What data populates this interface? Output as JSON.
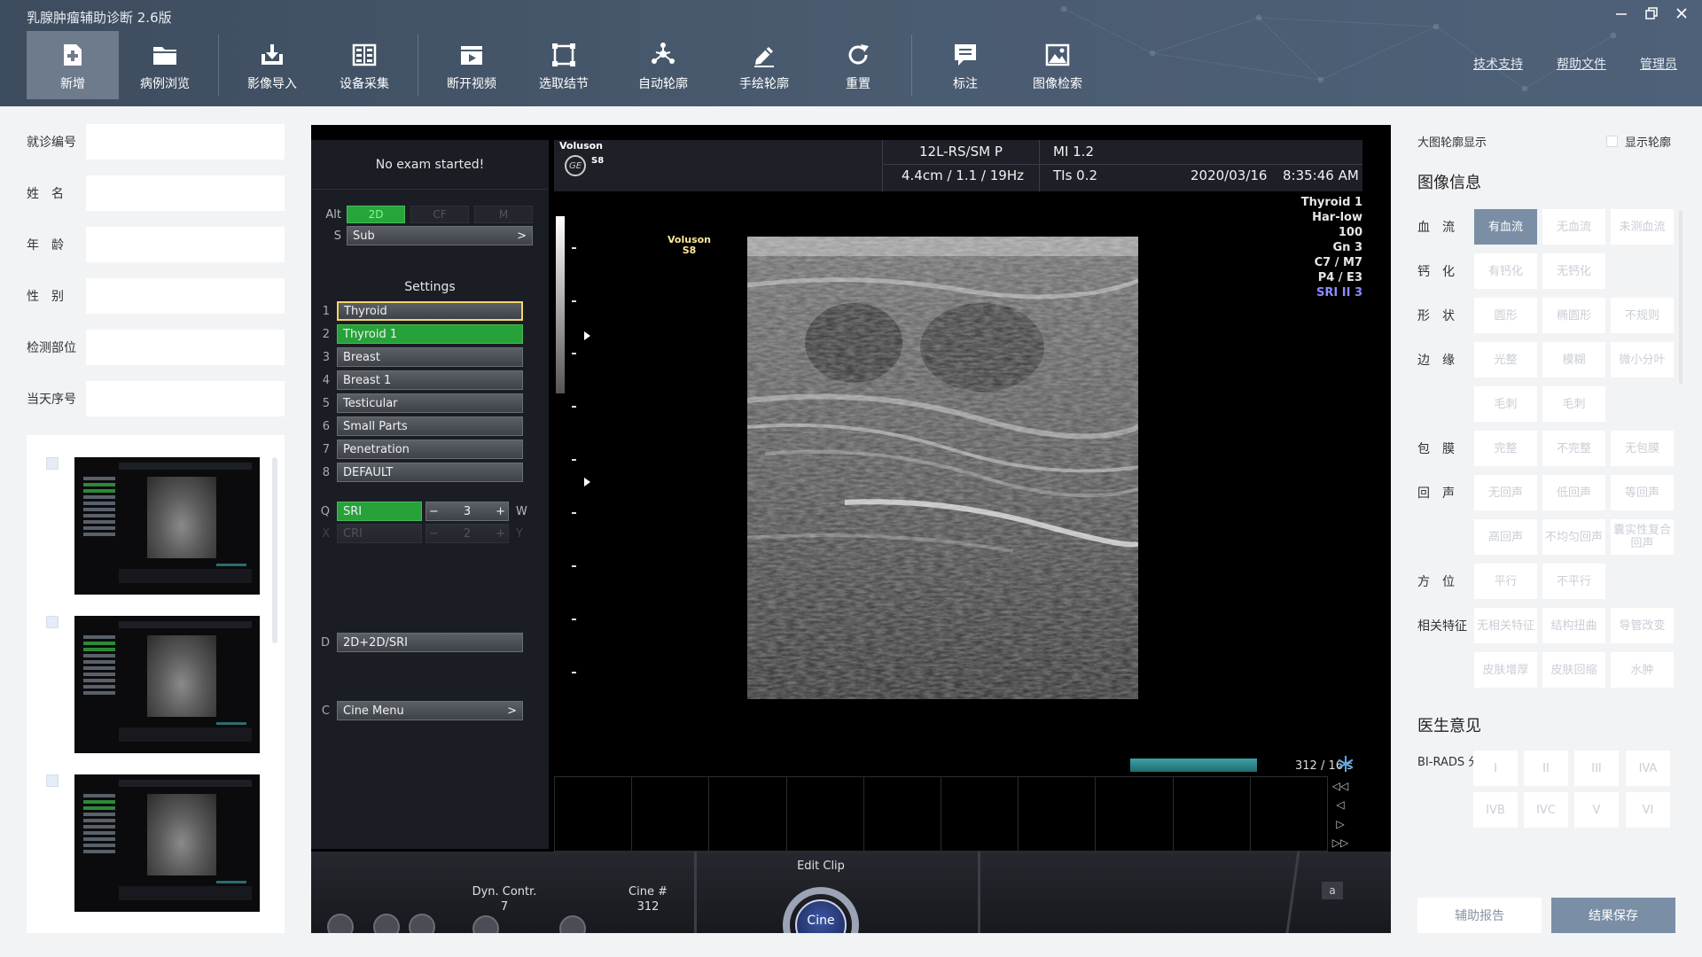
{
  "app": {
    "title": "乳腺肿瘤辅助诊断 2.6版"
  },
  "toolbar": {
    "items": [
      {
        "label": "新增",
        "icon": "add-file-icon"
      },
      {
        "label": "病例浏览",
        "icon": "folder-icon"
      },
      {
        "label": "影像导入",
        "icon": "download-icon"
      },
      {
        "label": "设备采集",
        "icon": "capture-icon"
      },
      {
        "label": "断开视频",
        "icon": "video-icon"
      },
      {
        "label": "选取结节",
        "icon": "select-rect-icon"
      },
      {
        "label": "自动轮廓",
        "icon": "nodes-icon"
      },
      {
        "label": "手绘轮廓",
        "icon": "pencil-icon"
      },
      {
        "label": "重置",
        "icon": "reset-icon"
      },
      {
        "label": "标注",
        "icon": "comment-icon"
      },
      {
        "label": "图像检索",
        "icon": "image-icon"
      }
    ]
  },
  "header_links": {
    "support": "技术支持",
    "help": "帮助文件",
    "admin": "管理员"
  },
  "patient_form": {
    "fields": [
      {
        "label": "就诊编号",
        "value": ""
      },
      {
        "label": "姓　名",
        "value": ""
      },
      {
        "label": "年　龄",
        "value": ""
      },
      {
        "label": "性　别",
        "value": ""
      },
      {
        "label": "检测部位",
        "value": ""
      },
      {
        "label": "当天序号",
        "value": ""
      }
    ]
  },
  "ultrasound": {
    "exam_status": "No exam started!",
    "modes": {
      "alt_key": "Alt",
      "btn1": "2D",
      "btn2": "CF",
      "btn3": "M"
    },
    "sub": {
      "key": "S",
      "label": "Sub",
      "arrow": ">"
    },
    "settings_title": "Settings",
    "presets": [
      {
        "n": "1",
        "label": "Thyroid"
      },
      {
        "n": "2",
        "label": "Thyroid 1"
      },
      {
        "n": "3",
        "label": "Breast"
      },
      {
        "n": "4",
        "label": "Breast 1"
      },
      {
        "n": "5",
        "label": "Testicular"
      },
      {
        "n": "6",
        "label": "Small Parts"
      },
      {
        "n": "7",
        "label": "Penetration"
      },
      {
        "n": "8",
        "label": "DEFAULT"
      }
    ],
    "sri": {
      "key": "Q",
      "label": "SRI",
      "value": "3",
      "w": "W",
      "minus": "−",
      "plus": "+"
    },
    "cri": {
      "key": "X",
      "label": "CRI",
      "value": "2",
      "y": "Y",
      "minus": "−",
      "plus": "+"
    },
    "d_row": {
      "key": "D",
      "label": "2D+2D/SRI"
    },
    "c_row": {
      "key": "C",
      "label": "Cine Menu",
      "arrow": ">"
    },
    "brand_top": "Voluson",
    "brand_model": "S8",
    "ge": "GE",
    "probe": "12L-RS/SM P",
    "depth": "4.4cm / 1.1 / 19Hz",
    "mi": "MI  1.2",
    "tis": "TIs  0.2",
    "date": "2020/03/16",
    "time": "8:35:46 AM",
    "params": [
      "Thyroid 1",
      "Har-low",
      "100",
      "Gn   3",
      "C7 / M7",
      "P4 / E3",
      "SRI II 3"
    ],
    "mini_brand": "Voluson",
    "mini_model": "S8",
    "cine_count": "312 / 16 s",
    "cine_progress": 1.0,
    "bottom": {
      "dyn_label": "Dyn. Contr.",
      "dyn_value": "7",
      "cine_label": "Cine #",
      "cine_value": "312",
      "edit_clip": "Edit Clip",
      "cine_btn": "Cine",
      "a_btn": "a"
    }
  },
  "right_panel": {
    "contour_label": "大图轮廓显示",
    "show_contour": "显示轮廓",
    "image_info_title": "图像信息",
    "features": [
      {
        "label": "血　流",
        "options": [
          "有血流",
          "无血流",
          "未测血流"
        ],
        "selected": 0
      },
      {
        "label": "钙　化",
        "options": [
          "有钙化",
          "无钙化"
        ],
        "selected": -1
      },
      {
        "label": "形　状",
        "options": [
          "圆形",
          "椭圆形",
          "不规则"
        ],
        "selected": -1
      },
      {
        "label": "边　缘",
        "options": [
          "光整",
          "模糊",
          "微小分叶",
          "毛刺",
          "毛刺"
        ],
        "selected": -1
      },
      {
        "label": "包　膜",
        "options": [
          "完整",
          "不完整",
          "无包膜"
        ],
        "selected": -1
      },
      {
        "label": "回　声",
        "options": [
          "无回声",
          "低回声",
          "等回声",
          "高回声",
          "不均匀回声",
          "囊实性复合回声"
        ],
        "selected": -1
      },
      {
        "label": "方　位",
        "options": [
          "平行",
          "不平行"
        ],
        "selected": -1
      },
      {
        "label": "相关特征",
        "options": [
          "无相关特征",
          "结构扭曲",
          "导管改变",
          "皮肤增厚",
          "皮肤回缩",
          "水肿"
        ],
        "selected": -1
      }
    ],
    "doctor_title": "医生意见",
    "birads_label": "BI-RADS 分类",
    "birads_options": [
      "I",
      "II",
      "III",
      "IVA",
      "IVB",
      "IVC",
      "V",
      "VI"
    ],
    "report_btn": "辅助报告",
    "save_btn": "结果保存"
  },
  "colors": {
    "header_bg": "#4a5b70",
    "accent": "#7a8ea6",
    "green": "#27a13a"
  }
}
